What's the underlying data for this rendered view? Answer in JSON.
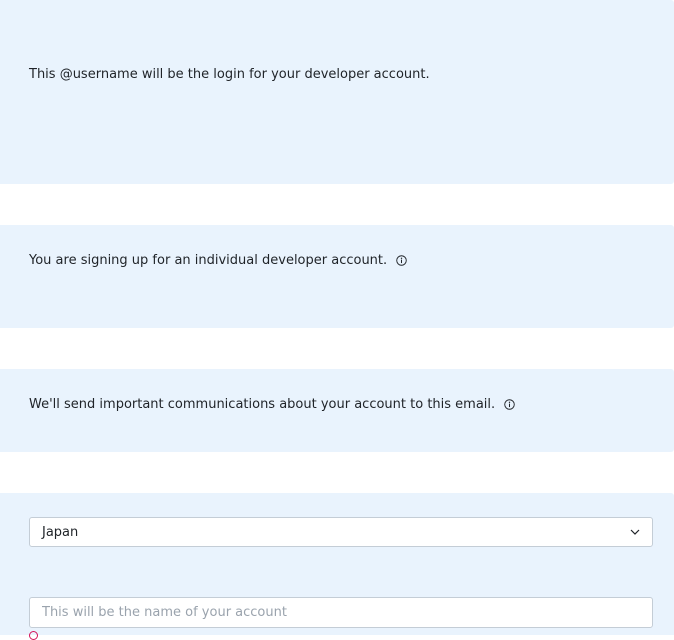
{
  "sections": {
    "username_note": "This @username will be the login for your developer account.",
    "account_type_note": "You are signing up for an individual developer account.",
    "email_note": "We'll send important communications about your account to this email."
  },
  "form": {
    "country_value": "Japan",
    "account_name_placeholder": "This will be the name of your account",
    "account_name_value": ""
  },
  "icons": {
    "info": "info-icon",
    "dropdown": "chevron-down-icon",
    "error": "error-icon"
  },
  "colors": {
    "panel_bg": "#e9f3fd",
    "border": "#c4cdd6",
    "error": "#d4145a",
    "text": "#1f2328",
    "placeholder": "#9aa3ad"
  }
}
